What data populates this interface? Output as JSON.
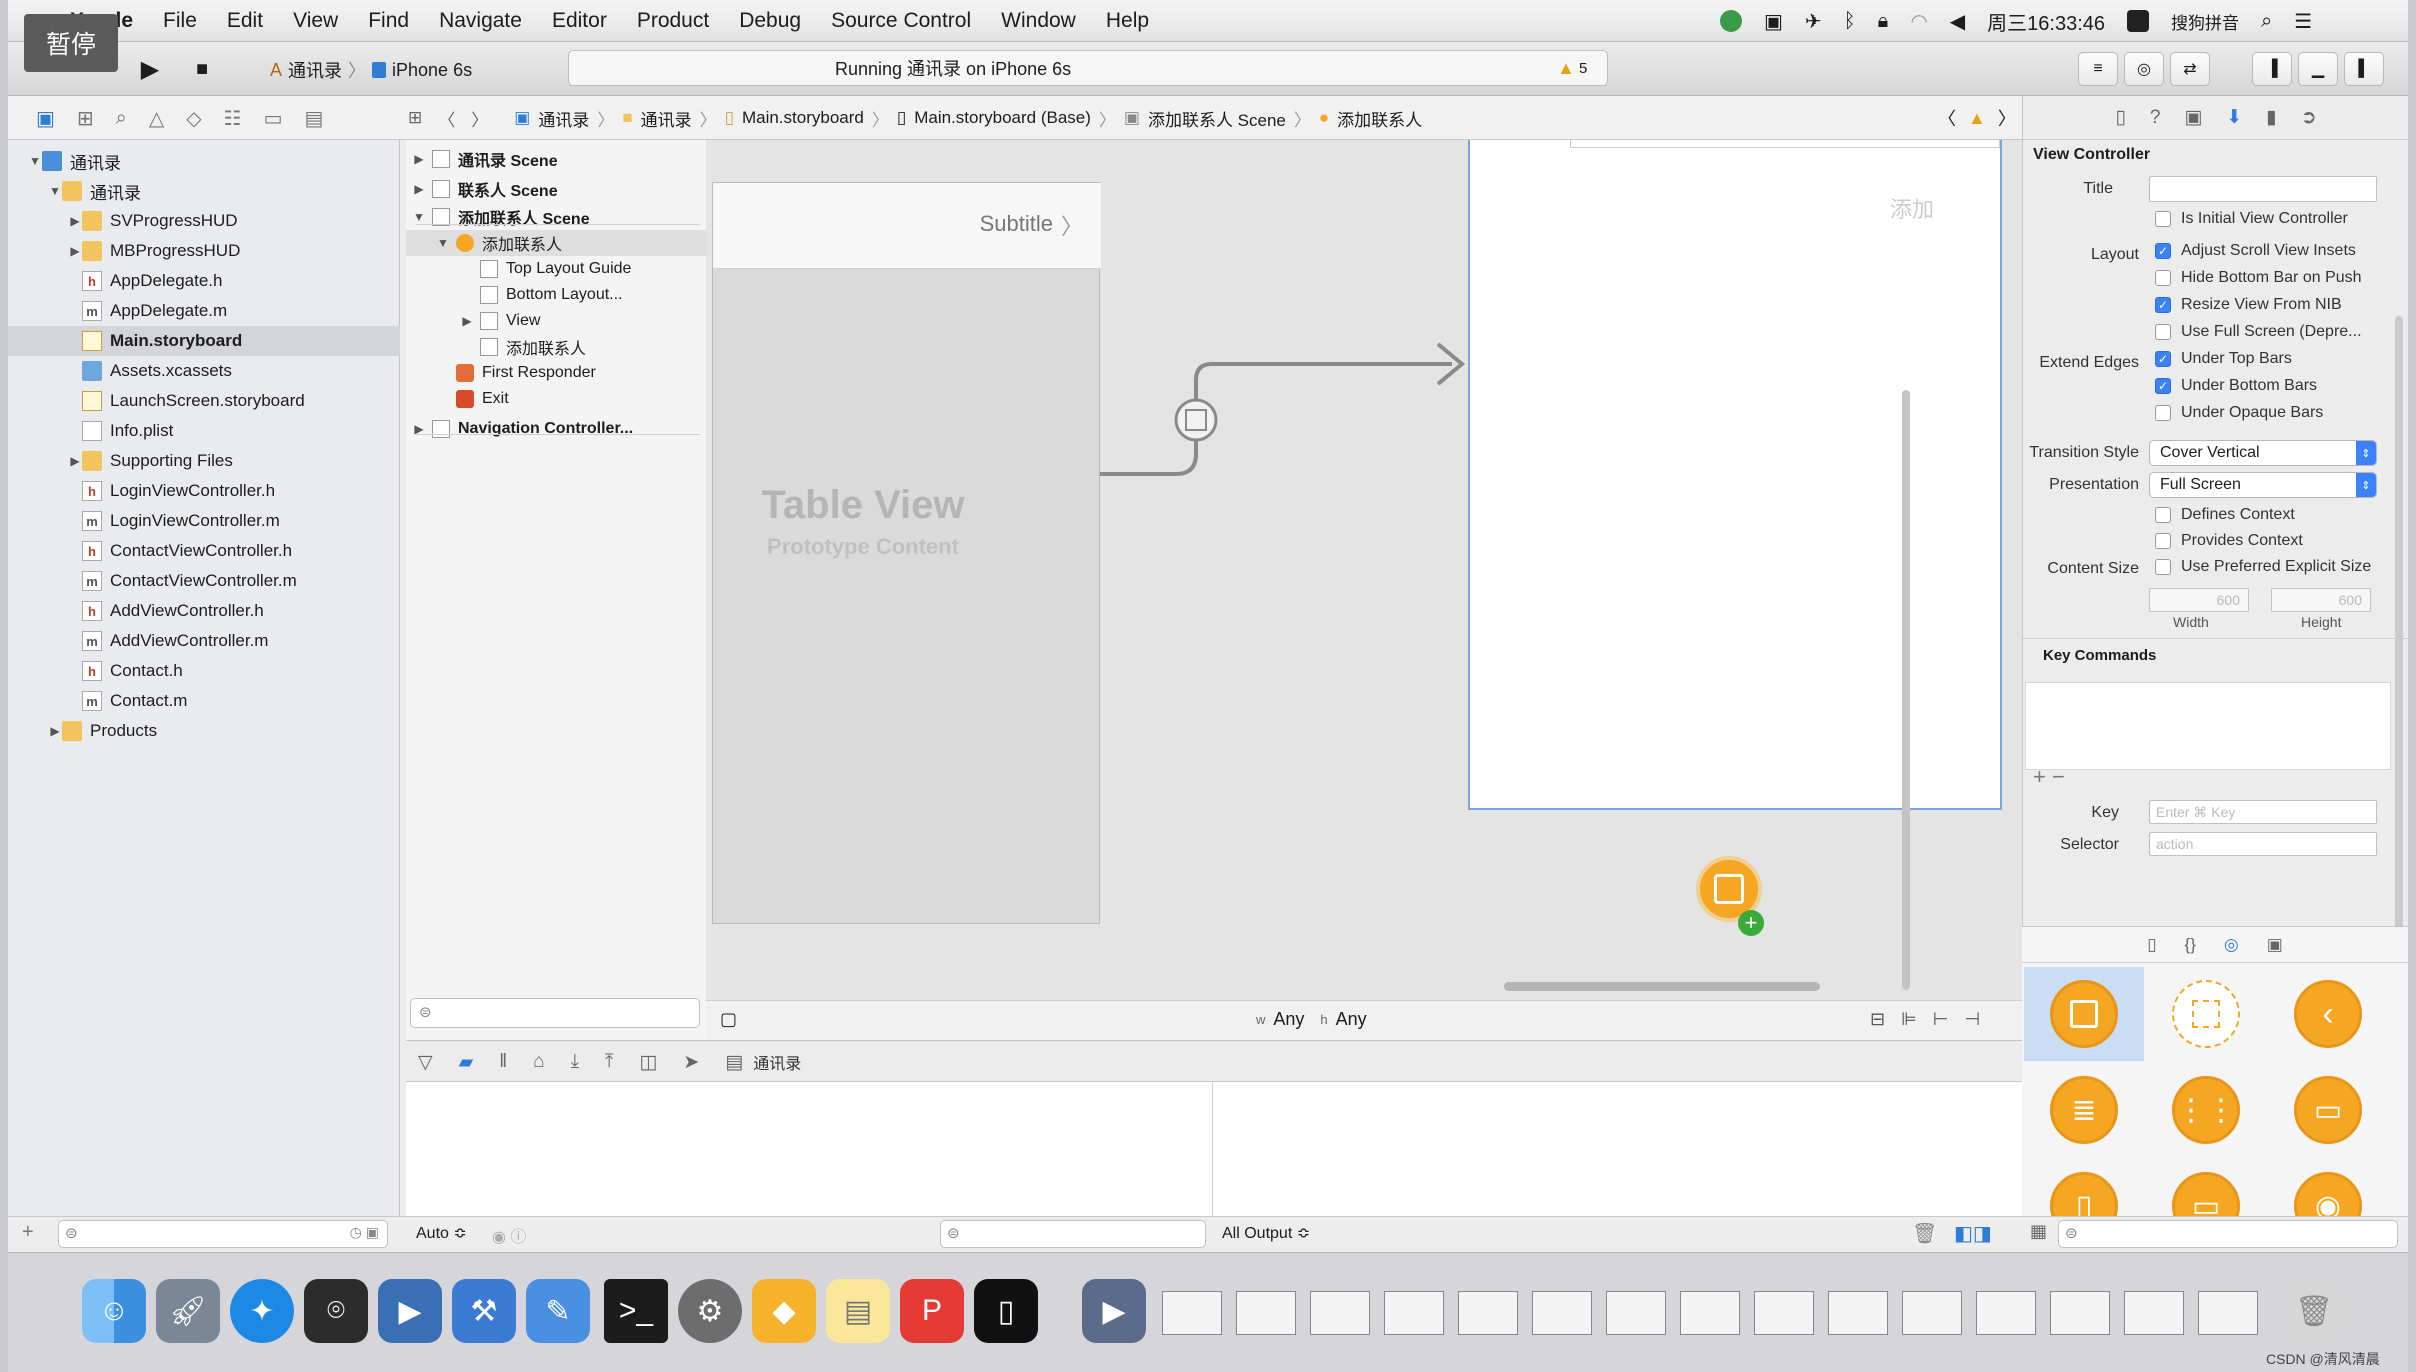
{
  "menubar": {
    "apple": "",
    "app": "Xcode",
    "items": [
      "File",
      "Edit",
      "View",
      "Find",
      "Navigate",
      "Editor",
      "Product",
      "Debug",
      "Source Control",
      "Window",
      "Help"
    ],
    "clock": "周三16:33:46",
    "ime": "搜狗拼音"
  },
  "toolbar": {
    "pause_label": "暂停",
    "scheme": "通讯录",
    "device": "iPhone 6s",
    "activity": "Running 通讯录 on iPhone 6s",
    "warning_count": "5"
  },
  "breadcrumb": [
    "通讯录",
    "通讯录",
    "Main.storyboard",
    "Main.storyboard (Base)",
    "添加联系人 Scene",
    "添加联系人"
  ],
  "navigator": {
    "items": [
      {
        "label": "通讯录",
        "indent": 0,
        "icon": "proj",
        "disc": "▼"
      },
      {
        "label": "通讯录",
        "indent": 1,
        "icon": "folder",
        "disc": "▼"
      },
      {
        "label": "SVProgressHUD",
        "indent": 2,
        "icon": "folder",
        "disc": "▶"
      },
      {
        "label": "MBProgressHUD",
        "indent": 2,
        "icon": "folder",
        "disc": "▶"
      },
      {
        "label": "AppDelegate.h",
        "indent": 2,
        "icon": "h",
        "disc": ""
      },
      {
        "label": "AppDelegate.m",
        "indent": 2,
        "icon": "m",
        "disc": ""
      },
      {
        "label": "Main.storyboard",
        "indent": 2,
        "icon": "sb",
        "disc": "",
        "selected": true
      },
      {
        "label": "Assets.xcassets",
        "indent": 2,
        "icon": "assets",
        "disc": ""
      },
      {
        "label": "LaunchScreen.storyboard",
        "indent": 2,
        "icon": "sb",
        "disc": ""
      },
      {
        "label": "Info.plist",
        "indent": 2,
        "icon": "plist",
        "disc": ""
      },
      {
        "label": "Supporting Files",
        "indent": 2,
        "icon": "folder",
        "disc": "▶"
      },
      {
        "label": "LoginViewController.h",
        "indent": 2,
        "icon": "h",
        "disc": ""
      },
      {
        "label": "LoginViewController.m",
        "indent": 2,
        "icon": "m",
        "disc": ""
      },
      {
        "label": "ContactViewController.h",
        "indent": 2,
        "icon": "h",
        "disc": ""
      },
      {
        "label": "ContactViewController.m",
        "indent": 2,
        "icon": "m",
        "disc": ""
      },
      {
        "label": "AddViewController.h",
        "indent": 2,
        "icon": "h",
        "disc": ""
      },
      {
        "label": "AddViewController.m",
        "indent": 2,
        "icon": "m",
        "disc": ""
      },
      {
        "label": "Contact.h",
        "indent": 2,
        "icon": "h",
        "disc": ""
      },
      {
        "label": "Contact.m",
        "indent": 2,
        "icon": "m",
        "disc": ""
      },
      {
        "label": "Products",
        "indent": 1,
        "icon": "folder",
        "disc": "▶"
      }
    ]
  },
  "outline": {
    "items": [
      {
        "label": "通讯录 Scene",
        "indent": 0,
        "disc": "▶",
        "bold": true
      },
      {
        "label": "联系人 Scene",
        "indent": 0,
        "disc": "▶",
        "bold": true
      },
      {
        "label": "添加联系人 Scene",
        "indent": 0,
        "disc": "▼",
        "bold": true
      },
      {
        "label": "添加联系人",
        "indent": 1,
        "disc": "▼",
        "selected": true
      },
      {
        "label": "Top Layout Guide",
        "indent": 2,
        "disc": ""
      },
      {
        "label": "Bottom Layout...",
        "indent": 2,
        "disc": ""
      },
      {
        "label": "View",
        "indent": 2,
        "disc": "▶"
      },
      {
        "label": "添加联系人",
        "indent": 2,
        "disc": ""
      },
      {
        "label": "First Responder",
        "indent": 1,
        "disc": ""
      },
      {
        "label": "Exit",
        "indent": 1,
        "disc": ""
      },
      {
        "label": "Navigation Controller...",
        "indent": 0,
        "disc": "▶",
        "bold": true
      }
    ]
  },
  "canvas": {
    "cell_subtitle": "Subtitle",
    "table_title": "Table View",
    "table_subtitle": "Prototype Content",
    "vc_button": "添加",
    "size_w": "Any",
    "size_h": "Any",
    "w_prefix": "w",
    "h_prefix": "h"
  },
  "debug": {
    "target": "通讯录",
    "auto": "Auto ≎",
    "all_output": "All Output ≎"
  },
  "inspector": {
    "section": "View Controller",
    "title_label": "Title",
    "title_value": "",
    "initial": "Is Initial View Controller",
    "layout_label": "Layout",
    "layout_opts": [
      {
        "label": "Adjust Scroll View Insets",
        "on": true
      },
      {
        "label": "Hide Bottom Bar on Push",
        "on": false
      },
      {
        "label": "Resize View From NIB",
        "on": true
      },
      {
        "label": "Use Full Screen (Depre...",
        "on": false
      }
    ],
    "extend_label": "Extend Edges",
    "extend_opts": [
      {
        "label": "Under Top Bars",
        "on": true
      },
      {
        "label": "Under Bottom Bars",
        "on": true
      },
      {
        "label": "Under Opaque Bars",
        "on": false
      }
    ],
    "transition_label": "Transition Style",
    "transition_value": "Cover Vertical",
    "presentation_label": "Presentation",
    "presentation_value": "Full Screen",
    "defines": "Defines Context",
    "provides": "Provides Context",
    "content_size_label": "Content Size",
    "preferred": "Use Preferred Explicit Size",
    "width_val": "600",
    "height_val": "600",
    "width_label": "Width",
    "height_label": "Height",
    "key_commands": "Key Commands",
    "key_label": "Key",
    "key_placeholder": "Enter ⌘ Key",
    "selector_label": "Selector",
    "selector_placeholder": "action"
  },
  "watermark": "CSDN @清风清晨"
}
